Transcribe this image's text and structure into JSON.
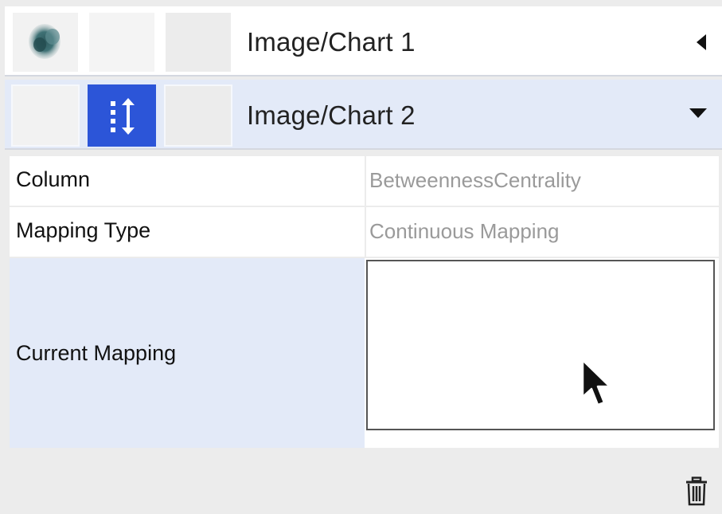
{
  "panel": {
    "properties": [
      {
        "title": "Image/Chart 1",
        "expand_state": "collapsed",
        "arrow_icon": "triangle-left-icon"
      },
      {
        "title": "Image/Chart 2",
        "expand_state": "expanded",
        "arrow_icon": "triangle-down-icon"
      }
    ],
    "row2_active_cell_icon": "continuous-mapping-icon",
    "accent_color": "#2c55d8",
    "selected_row_color": "#e3eaf8"
  },
  "mapping": {
    "column_label": "Column",
    "column_value": "BetweennessCentrality",
    "mapping_type_label": "Mapping Type",
    "mapping_type_value": "Continuous Mapping",
    "current_mapping_label": "Current Mapping"
  },
  "actions": {
    "delete_icon": "trash-icon"
  }
}
